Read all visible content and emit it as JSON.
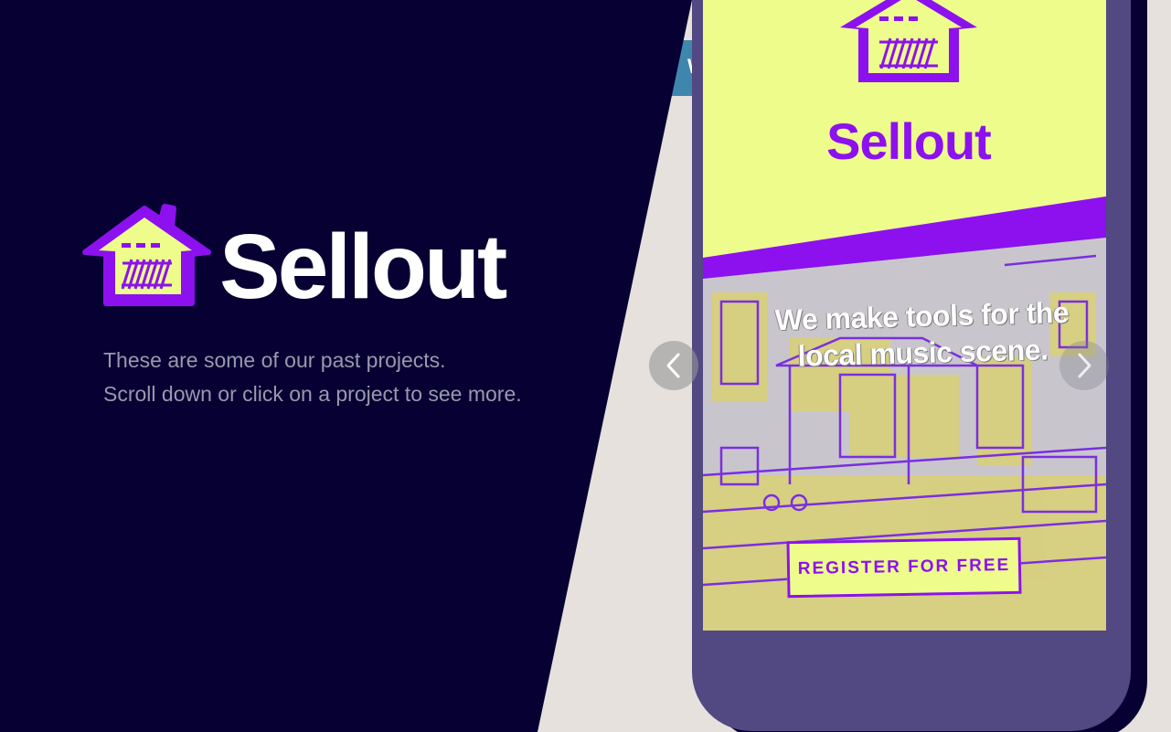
{
  "brand": {
    "name": "Sellout",
    "tagline_line1": "These are some of our past projects.",
    "tagline_line2": "Scroll down or click on a project to see more."
  },
  "background_strip": {
    "text": "W"
  },
  "slide": {
    "app_title": "Sellout",
    "hero_line1": "We make tools for the",
    "hero_line2": "local music scene.",
    "cta_label": "REGISTER FOR FREE"
  },
  "carousel": {
    "prev_icon": "chevron-left-icon",
    "next_icon": "chevron-right-icon"
  },
  "colors": {
    "background_dark": "#070033",
    "page_light": "#e6e1dd",
    "brand_purple": "#8c11ee",
    "brand_yellow": "#eefc8c",
    "phone_frame": "#524882",
    "tagline_gray": "#9a98ad",
    "strip_blue": "#3f86ad"
  }
}
